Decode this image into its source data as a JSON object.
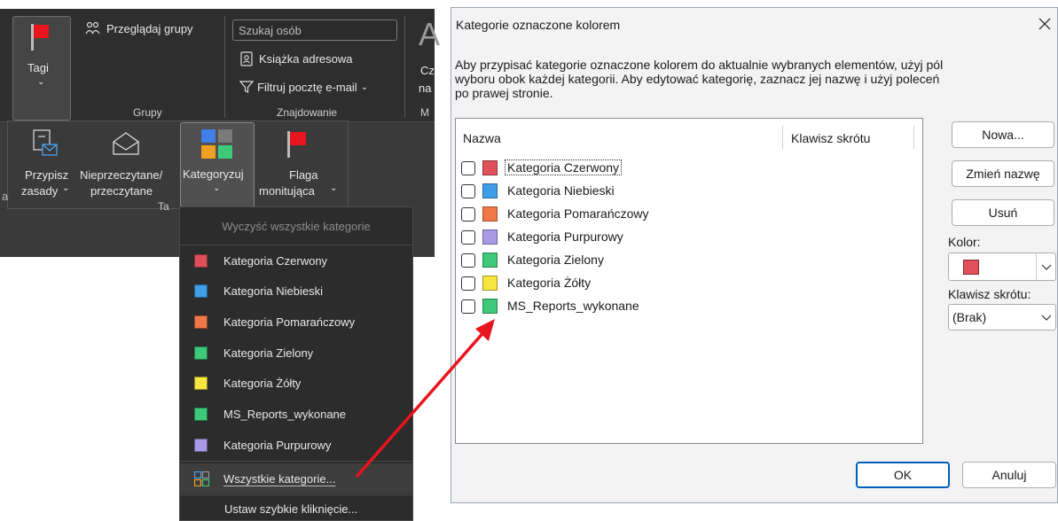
{
  "ribbon": {
    "tags_label": "Tagi",
    "browse_groups": "Przeglądaj grupy",
    "groups_title": "Grupy",
    "search_placeholder": "Szukaj osób",
    "address_book": "Książka adresowa",
    "filter_email": "Filtruj pocztę e-mail",
    "find_title": "Znajdowanie",
    "cut_letter": "A",
    "cut_cz": "Cz",
    "cut_na": "na",
    "cut_m": "M",
    "assign_policy_1": "Przypisz",
    "assign_policy_2": "zasady",
    "unread_read_1": "Nieprzeczytane/",
    "unread_read_2": "przeczytane",
    "categorize": "Kategoryzuj",
    "follow_up_1": "Flaga",
    "follow_up_2": "monitująca",
    "cut_a": "a",
    "cut_ta": "Ta"
  },
  "dropdown": {
    "clear_all": "Wyczyść wszystkie kategorie",
    "items": [
      {
        "label": "Kategoria Czerwony",
        "color": "#e0505a"
      },
      {
        "label": "Kategoria Niebieski",
        "color": "#3f9ee8"
      },
      {
        "label": "Kategoria Pomarańczowy",
        "color": "#f07848"
      },
      {
        "label": "Kategoria Zielony",
        "color": "#3ec97a"
      },
      {
        "label": "Kategoria Żółty",
        "color": "#f7e540"
      },
      {
        "label": "MS_Reports_wykonane",
        "color": "#3ec97a"
      },
      {
        "label": "Kategoria Purpurowy",
        "color": "#a99ae6"
      }
    ],
    "all_categories": "Wszystkie kategorie...",
    "quick_click": "Ustaw szybkie kliknięcie..."
  },
  "dialog": {
    "title": "Kategorie oznaczone kolorem",
    "instructions_1": "Aby przypisać kategorie oznaczone kolorem do aktualnie wybranych elementów, użyj pól",
    "instructions_2": "wyboru obok każdej kategorii. Aby edytować kategorię, zaznacz jej nazwę i użyj poleceń",
    "instructions_3": "po prawej stronie.",
    "col_name": "Nazwa",
    "col_shortcut": "Klawisz skrótu",
    "rows": [
      {
        "label": "Kategoria Czerwony",
        "color": "#e0505a"
      },
      {
        "label": "Kategoria Niebieski",
        "color": "#3f9ee8"
      },
      {
        "label": "Kategoria Pomarańczowy",
        "color": "#f07848"
      },
      {
        "label": "Kategoria Purpurowy",
        "color": "#a99ae6"
      },
      {
        "label": "Kategoria Zielony",
        "color": "#3ec97a"
      },
      {
        "label": "Kategoria Żółty",
        "color": "#f7e540"
      },
      {
        "label": "MS_Reports_wykonane",
        "color": "#3ec97a"
      }
    ],
    "btn_new": "Nowa...",
    "btn_rename": "Zmień nazwę",
    "btn_delete": "Usuń",
    "color_label": "Kolor:",
    "selected_color": "#e0505a",
    "shortcut_label": "Klawisz skrótu:",
    "shortcut_value": "(Brak)",
    "btn_ok": "OK",
    "btn_cancel": "Anuluj"
  },
  "colors": {
    "arrow": "#e8141e",
    "flag": "#e8141e"
  }
}
